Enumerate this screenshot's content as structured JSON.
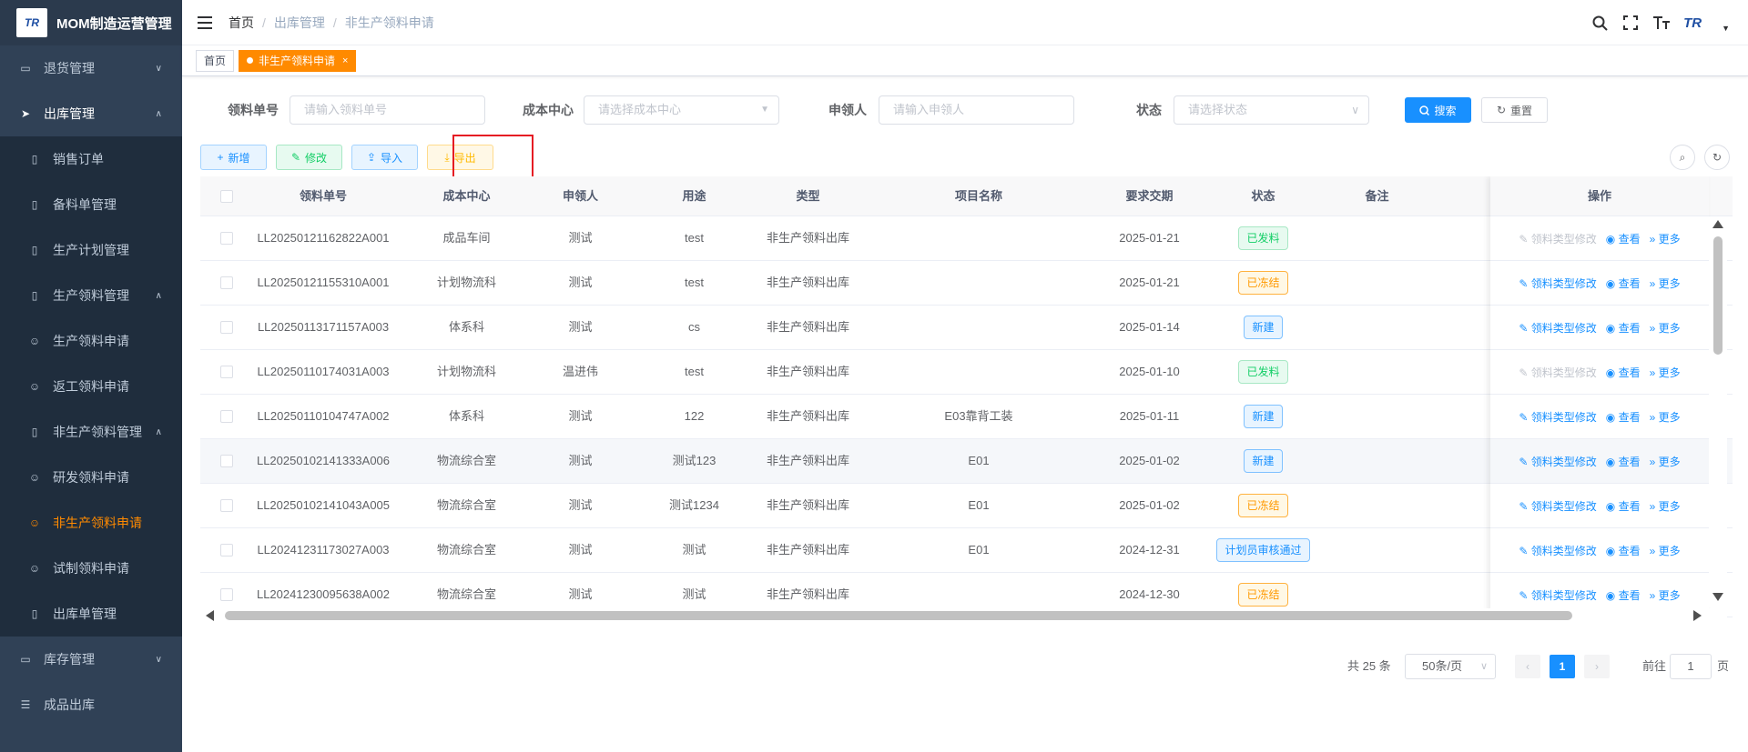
{
  "app": {
    "title": "MOM制造运营管理",
    "logo_text": "TR"
  },
  "sidebar": {
    "items": [
      {
        "label": "退货管理",
        "icon": "monitor-icon",
        "arrow": "∨",
        "level": 0
      },
      {
        "label": "出库管理",
        "icon": "send-icon",
        "arrow": "∧",
        "level": 0,
        "open": true
      },
      {
        "label": "销售订单",
        "icon": "book-icon",
        "level": 1
      },
      {
        "label": "备料单管理",
        "icon": "book-icon",
        "level": 1
      },
      {
        "label": "生产计划管理",
        "icon": "book-icon",
        "level": 1
      },
      {
        "label": "生产领料管理",
        "icon": "book-icon",
        "arrow": "∧",
        "level": 1
      },
      {
        "label": "生产领料申请",
        "icon": "user-chat-icon",
        "level": 1
      },
      {
        "label": "返工领料申请",
        "icon": "user-chat-icon",
        "level": 1
      },
      {
        "label": "非生产领料管理",
        "icon": "book-icon",
        "arrow": "∧",
        "level": 1
      },
      {
        "label": "研发领料申请",
        "icon": "user-chat-icon",
        "level": 1
      },
      {
        "label": "非生产领料申请",
        "icon": "user-chat-icon",
        "level": 1,
        "active": true
      },
      {
        "label": "试制领料申请",
        "icon": "user-chat-icon",
        "level": 1
      },
      {
        "label": "出库单管理",
        "icon": "book-icon",
        "level": 1
      },
      {
        "label": "库存管理",
        "icon": "monitor-icon",
        "arrow": "∨",
        "level": 0
      },
      {
        "label": "成品出库",
        "icon": "list-icon",
        "level": 0
      }
    ]
  },
  "breadcrumb": [
    "首页",
    "出库管理",
    "非生产领料申请"
  ],
  "tags": [
    {
      "label": "首页"
    },
    {
      "label": "非生产领料申请",
      "active": true,
      "close": "×"
    }
  ],
  "filters": {
    "code_label": "领料单号",
    "code_placeholder": "请输入领料单号",
    "cost_label": "成本中心",
    "cost_placeholder": "请选择成本中心",
    "applicant_label": "申领人",
    "applicant_placeholder": "请输入申领人",
    "status_label": "状态",
    "status_placeholder": "请选择状态",
    "search": "搜索",
    "reset": "重置"
  },
  "toolbar": {
    "add": "新增",
    "edit": "修改",
    "import": "导入",
    "export": "导出"
  },
  "table": {
    "columns": [
      "领料单号",
      "成本中心",
      "申领人",
      "用途",
      "类型",
      "项目名称",
      "要求交期",
      "状态",
      "备注",
      "操作"
    ],
    "rows": [
      {
        "code": "LL20250121162822A001",
        "cost": "成品车间",
        "applicant": "测试",
        "usage": "test",
        "type": "非生产领料出库",
        "project": "",
        "date": "2025-01-21",
        "status": "已发料",
        "status_color": "green",
        "note": "",
        "edit_disabled": true
      },
      {
        "code": "LL20250121155310A001",
        "cost": "计划物流科",
        "applicant": "测试",
        "usage": "test",
        "type": "非生产领料出库",
        "project": "",
        "date": "2025-01-21",
        "status": "已冻结",
        "status_color": "orange",
        "note": "",
        "edit_disabled": false
      },
      {
        "code": "LL20250113171157A003",
        "cost": "体系科",
        "applicant": "测试",
        "usage": "cs",
        "type": "非生产领料出库",
        "project": "",
        "date": "2025-01-14",
        "status": "新建",
        "status_color": "blue",
        "note": "",
        "edit_disabled": false
      },
      {
        "code": "LL20250110174031A003",
        "cost": "计划物流科",
        "applicant": "温进伟",
        "usage": "test",
        "type": "非生产领料出库",
        "project": "",
        "date": "2025-01-10",
        "status": "已发料",
        "status_color": "green",
        "note": "",
        "edit_disabled": true
      },
      {
        "code": "LL20250110104747A002",
        "cost": "体系科",
        "applicant": "测试",
        "usage": "122",
        "type": "非生产领料出库",
        "project": "E03靠背工装",
        "date": "2025-01-11",
        "status": "新建",
        "status_color": "blue",
        "note": "",
        "edit_disabled": false
      },
      {
        "code": "LL20250102141333A006",
        "cost": "物流综合室",
        "applicant": "测试",
        "usage": "测试123",
        "type": "非生产领料出库",
        "project": "E01",
        "date": "2025-01-02",
        "status": "新建",
        "status_color": "blue",
        "note": "",
        "edit_disabled": false,
        "highlight": true
      },
      {
        "code": "LL20250102141043A005",
        "cost": "物流综合室",
        "applicant": "测试",
        "usage": "测试1234",
        "type": "非生产领料出库",
        "project": "E01",
        "date": "2025-01-02",
        "status": "已冻结",
        "status_color": "orange",
        "note": "",
        "edit_disabled": false
      },
      {
        "code": "LL20241231173027A003",
        "cost": "物流综合室",
        "applicant": "测试",
        "usage": "测试",
        "type": "非生产领料出库",
        "project": "E01",
        "date": "2024-12-31",
        "status": "计划员审核通过",
        "status_color": "blue",
        "note": "",
        "edit_disabled": false
      },
      {
        "code": "LL20241230095638A002",
        "cost": "物流综合室",
        "applicant": "测试",
        "usage": "测试",
        "type": "非生产领料出库",
        "project": "",
        "date": "2024-12-30",
        "status": "已冻结",
        "status_color": "orange",
        "note": "",
        "edit_disabled": false
      }
    ],
    "ops": {
      "edit": "领料类型修改",
      "view": "查看",
      "more": "更多"
    }
  },
  "pagination": {
    "total": "共 25 条",
    "size": "50条/页",
    "current": "1",
    "goto_label": "前往",
    "goto_value": "1",
    "page_unit": "页"
  },
  "colors": {
    "sidebar_bg": "#304156",
    "accent": "#ff8a00",
    "primary": "#1890ff"
  }
}
